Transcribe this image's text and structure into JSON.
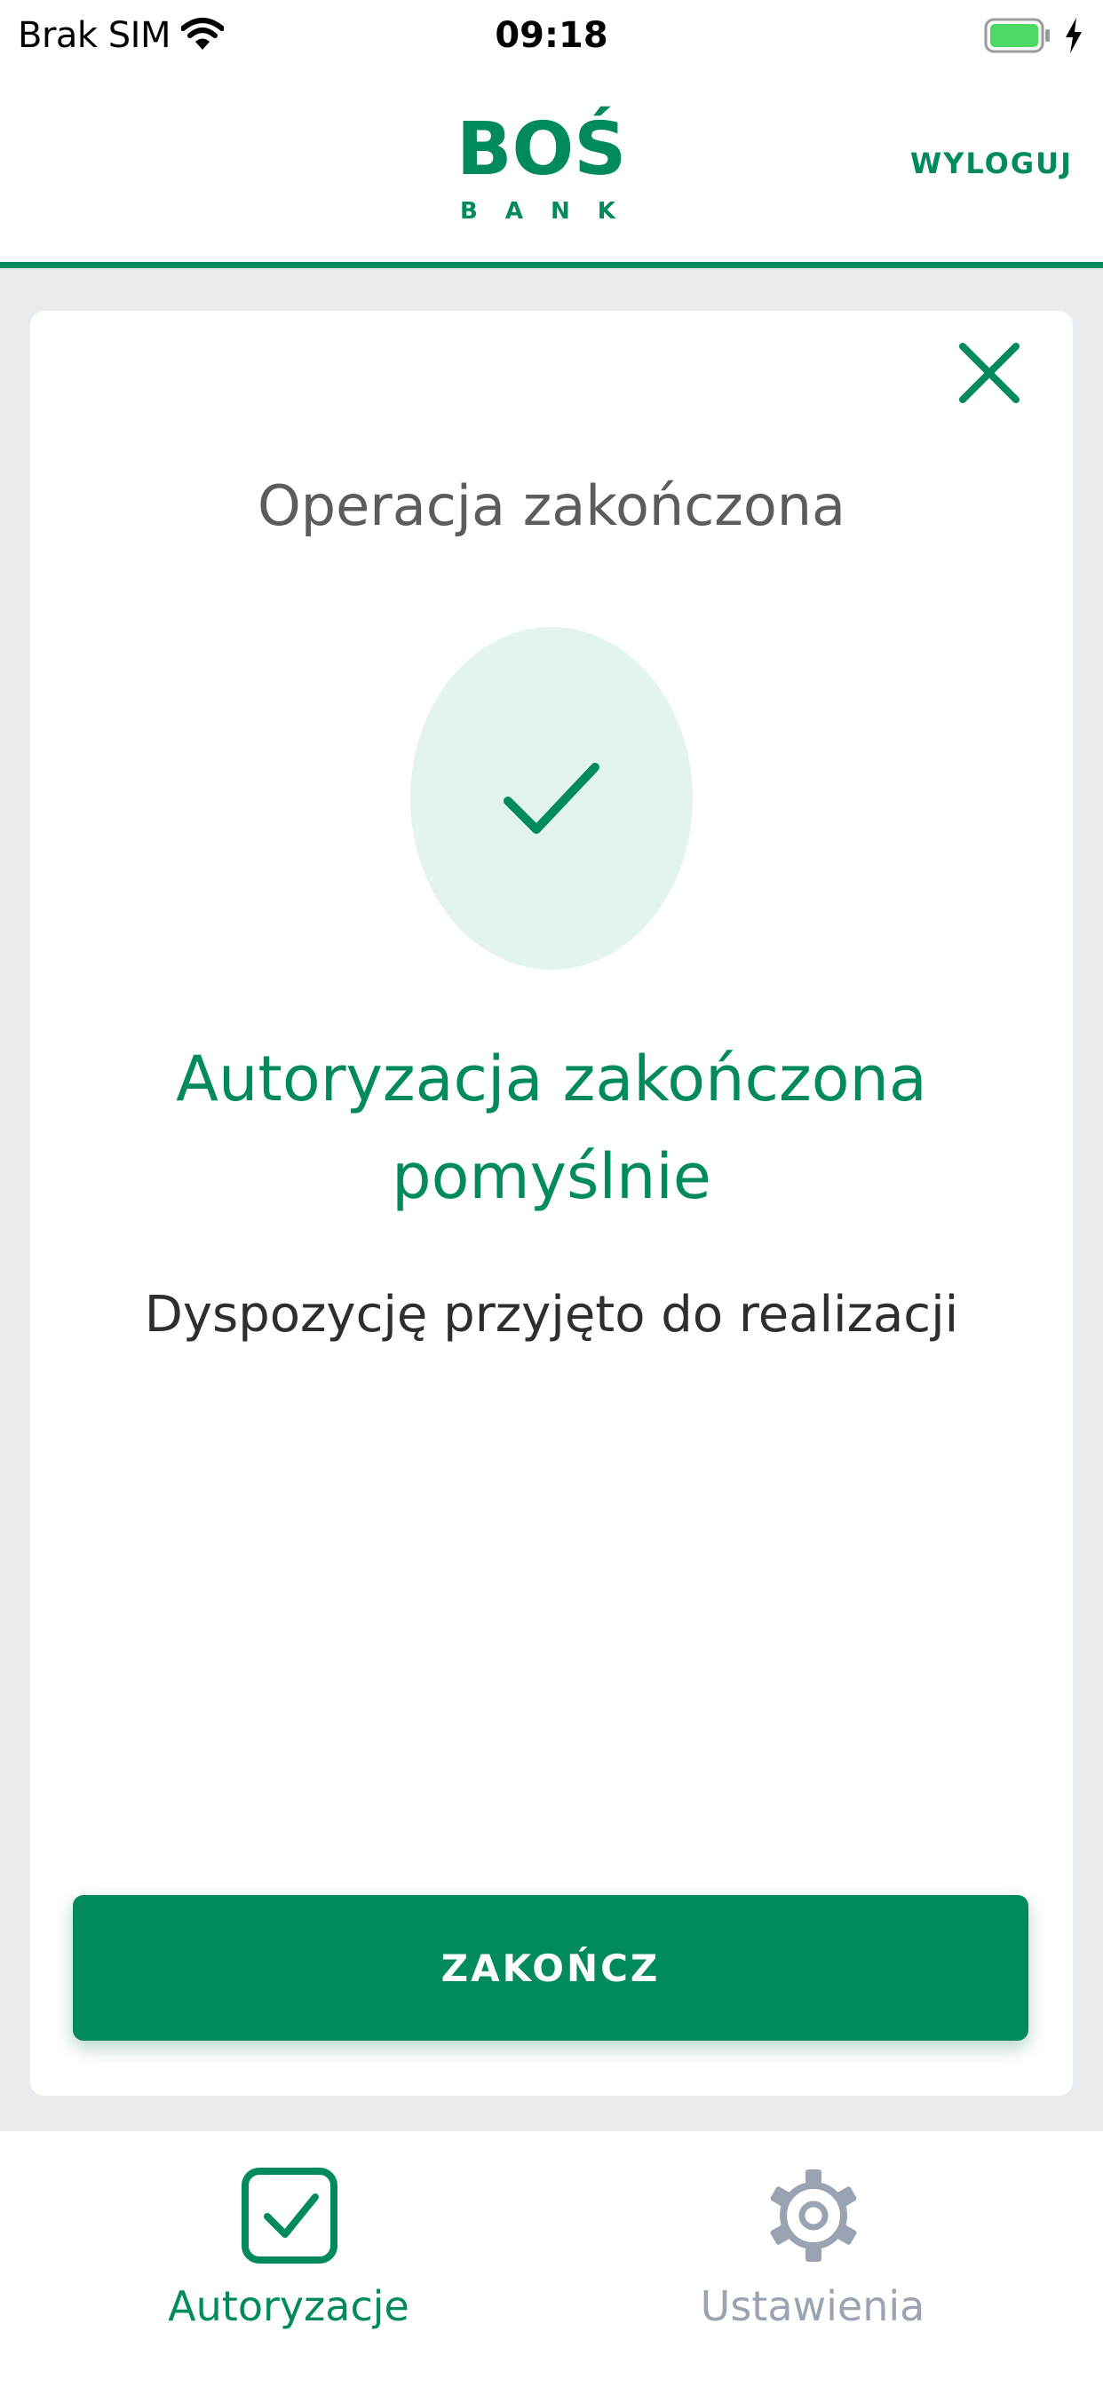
{
  "status_bar": {
    "carrier": "Brak SIM",
    "time": "09:18"
  },
  "header": {
    "logo_text": "BOŚ",
    "logo_subtext": "BANK",
    "logout_label": "WYLOGUJ"
  },
  "card": {
    "title": "Operacja zakończona",
    "result_title": "Autoryzacja zakończona pomyślnie",
    "result_message": "Dyspozycję przyjęto do realizacji",
    "finish_label": "ZAKOŃCZ"
  },
  "tab_bar": {
    "items": [
      {
        "label": "Autoryzacje",
        "icon": "checkbox-icon",
        "active": true
      },
      {
        "label": "Ustawienia",
        "icon": "gear-icon",
        "active": false
      }
    ]
  },
  "colors": {
    "brand_green": "#008a5e",
    "success_circle": "#e3f4ee",
    "page_background": "#e8ecef",
    "inactive_tab": "#9aa3b2",
    "battery_green": "#4cd964"
  }
}
